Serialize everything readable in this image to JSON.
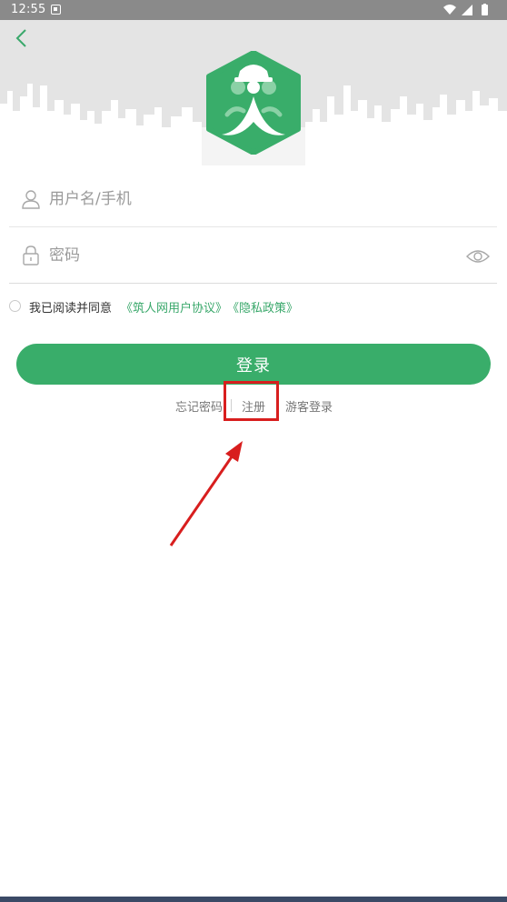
{
  "status_bar": {
    "time": "12:55",
    "icons": [
      "notification-icon",
      "wifi-icon",
      "signal-icon",
      "battery-icon"
    ]
  },
  "header": {
    "back_icon": "chevron-left-icon",
    "logo_icon": "worker-hardhat-logo-icon"
  },
  "form": {
    "username": {
      "placeholder": "用户名/手机",
      "value": "",
      "icon": "user-icon"
    },
    "password": {
      "placeholder": "密码",
      "value": "",
      "icon": "lock-icon",
      "toggle_icon": "eye-icon"
    }
  },
  "agreement": {
    "checked": false,
    "text": "我已阅读并同意",
    "user_agreement_link": "《筑人网用户协议》",
    "privacy_link": "《隐私政策》"
  },
  "login_button": "登录",
  "links": {
    "forgot": "忘记密码",
    "register": "注册",
    "guest": "游客登录"
  },
  "colors": {
    "primary_green": "#39ad6a",
    "link_green": "#3aa86b",
    "annotation_red": "#d81e1e",
    "header_bg": "#e4e4e4"
  }
}
